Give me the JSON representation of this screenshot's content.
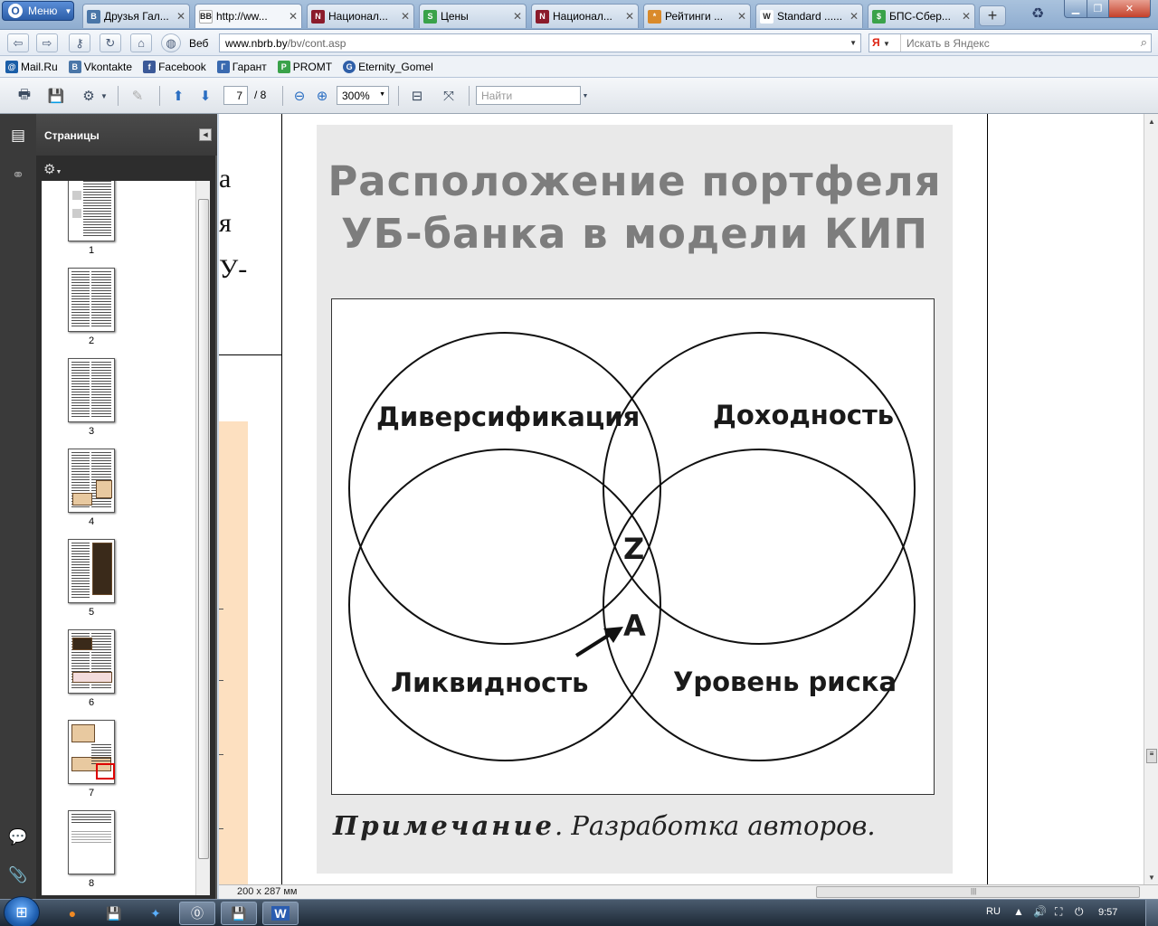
{
  "browser": {
    "menu_label": "Меню",
    "tabs": [
      {
        "title": "Друзья Гал...",
        "fav": "В",
        "fav_color": "#4a76a8"
      },
      {
        "title": "http://ww...",
        "fav": "BB",
        "fav_color": "#ffffff",
        "active": true
      },
      {
        "title": "Национал...",
        "fav": "N",
        "fav_color": "#8b1b2b"
      },
      {
        "title": "Цены",
        "fav": "S",
        "fav_color": "#3aa24a"
      },
      {
        "title": "Национал...",
        "fav": "N",
        "fav_color": "#8b1b2b"
      },
      {
        "title": "Рейтинги ...",
        "fav": "*",
        "fav_color": "#d98a2b"
      },
      {
        "title": "Standard ......",
        "fav": "W",
        "fav_color": "#ffffff"
      },
      {
        "title": "БПС-Сбер...",
        "fav": "$",
        "fav_color": "#3aa24a"
      }
    ],
    "add_tab": "+",
    "web_label": "Веб",
    "url_host": "www.nbrb.by",
    "url_path": "/bv/cont.asp",
    "yandex_placeholder": "Искать в Яндекс",
    "yandex_logo": "Я"
  },
  "bookmarks": [
    {
      "label": "Mail.Ru",
      "icon": "@",
      "color": "#1a5ea8"
    },
    {
      "label": "Vkontakte",
      "icon": "В",
      "color": "#4a76a8"
    },
    {
      "label": "Facebook",
      "icon": "f",
      "color": "#3b5998"
    },
    {
      "label": "Гарант",
      "icon": "Г",
      "color": "#3a6ab0"
    },
    {
      "label": "PROMT",
      "icon": "P",
      "color": "#3aa24a"
    },
    {
      "label": "Eternity_Gomel",
      "icon": "G",
      "color": "#2f5fa8"
    }
  ],
  "pdf_toolbar": {
    "current_page": "7",
    "total_pages": "/ 8",
    "zoom": "300%",
    "find_placeholder": "Найти"
  },
  "pages_panel": {
    "title": "Страницы",
    "thumbnails": [
      "1",
      "2",
      "3",
      "4",
      "5",
      "6",
      "7",
      "8"
    ]
  },
  "document": {
    "left_fragments": [
      "а",
      "я",
      "У-"
    ],
    "figure_title_line1": "Расположение портфеля",
    "figure_title_line2": "УБ-банка в модели КИП",
    "venn_labels": {
      "top_left": "Диверсификация",
      "top_right": "Доходность",
      "bottom_left": "Ликвидность",
      "bottom_right": "Уровень риска",
      "point_z": "Z",
      "point_a": "A"
    },
    "note_label": "Примечание",
    "note_text": ". Разработка авторов."
  },
  "status": {
    "page_size": "200 x 287 мм"
  },
  "taskbar": {
    "language": "RU",
    "clock": "9:57"
  }
}
